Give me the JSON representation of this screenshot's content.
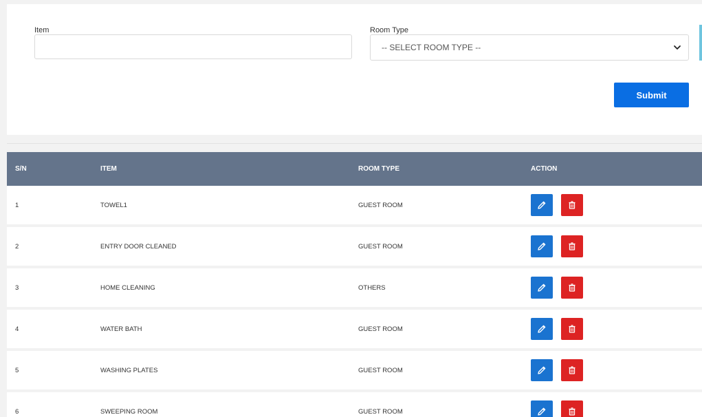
{
  "form": {
    "item_label": "Item",
    "item_value": "",
    "item_placeholder": "",
    "room_type_label": "Room Type",
    "room_type_selected": "-- SELECT ROOM TYPE --",
    "submit_label": "Submit"
  },
  "table": {
    "headers": {
      "sn": "S/N",
      "item": "ITEM",
      "room_type": "ROOM TYPE",
      "action": "ACTION"
    },
    "rows": [
      {
        "sn": "1",
        "item": "TOWEL1",
        "room_type": "GUEST ROOM"
      },
      {
        "sn": "2",
        "item": "ENTRY DOOR CLEANED",
        "room_type": "GUEST ROOM"
      },
      {
        "sn": "3",
        "item": "HOME CLEANING",
        "room_type": "OTHERS"
      },
      {
        "sn": "4",
        "item": "WATER BATH",
        "room_type": "GUEST ROOM"
      },
      {
        "sn": "5",
        "item": "WASHING PLATES",
        "room_type": "GUEST ROOM"
      },
      {
        "sn": "6",
        "item": "SWEEPING ROOM",
        "room_type": "GUEST ROOM"
      }
    ]
  },
  "icons": {
    "edit": "pencil-icon",
    "delete": "trash-icon",
    "dropdown": "chevron-down-icon"
  },
  "colors": {
    "primary": "#0a6ee3",
    "edit": "#1a73d0",
    "delete": "#dd2323",
    "table_header": "#64748b",
    "accent": "#6fc5df"
  }
}
